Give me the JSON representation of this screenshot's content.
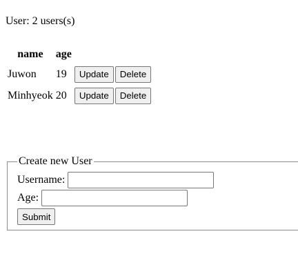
{
  "summary": {
    "label": "User: 2 users(s)"
  },
  "users_table": {
    "columns": [
      "name",
      "age"
    ],
    "rows": [
      {
        "name": "Juwon",
        "age": "19",
        "update_label": "Update",
        "delete_label": "Delete"
      },
      {
        "name": "Minhyeok",
        "age": "20",
        "update_label": "Update",
        "delete_label": "Delete"
      }
    ]
  },
  "create_form": {
    "legend": "Create new User",
    "username_label": "Username:",
    "username_value": "",
    "age_label": "Age:",
    "age_value": "",
    "submit_label": "Submit"
  }
}
